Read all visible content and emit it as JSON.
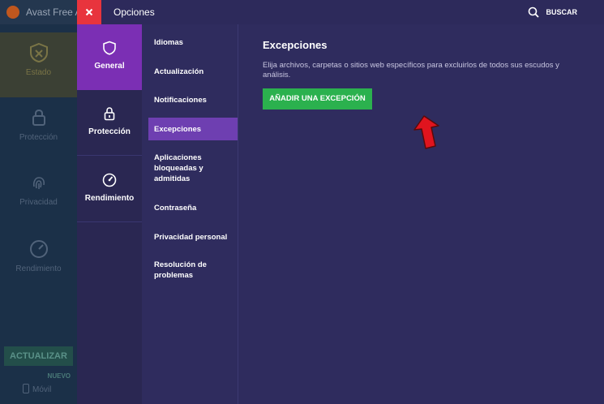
{
  "background_app": {
    "title": "Avast Free A",
    "nav": [
      {
        "label": "Estado",
        "icon": "shield-x-icon"
      },
      {
        "label": "Protección",
        "icon": "lock-icon"
      },
      {
        "label": "Privacidad",
        "icon": "fingerprint-icon"
      },
      {
        "label": "Rendimiento",
        "icon": "speedometer-icon"
      }
    ],
    "update_label": "ACTUALIZAR",
    "new_badge": "NUEVO",
    "mobile_label": "Móvil"
  },
  "options": {
    "title": "Opciones",
    "search_label": "BUSCAR",
    "categories": [
      {
        "label": "General",
        "icon": "shield-icon",
        "active": true
      },
      {
        "label": "Protección",
        "icon": "lock-icon",
        "active": false
      },
      {
        "label": "Rendimiento",
        "icon": "speedometer-icon",
        "active": false
      }
    ],
    "submenu": [
      {
        "label": "Idiomas"
      },
      {
        "label": "Actualización"
      },
      {
        "label": "Notificaciones"
      },
      {
        "label": "Excepciones",
        "active": true
      },
      {
        "label": "Aplicaciones bloqueadas y admitidas"
      },
      {
        "label": "Contraseña"
      },
      {
        "label": "Privacidad personal"
      },
      {
        "label": "Resolución de problemas"
      }
    ],
    "content": {
      "title": "Excepciones",
      "description": "Elija archivos, carpetas o sitios web específicos para excluirlos de todos sus escudos y análisis.",
      "add_button": "AÑADIR UNA EXCEPCIÓN"
    }
  },
  "colors": {
    "accent_purple": "#7b2fb4",
    "close_red": "#e8343d",
    "button_green": "#2bb14e",
    "arrow_red": "#e0141e"
  }
}
